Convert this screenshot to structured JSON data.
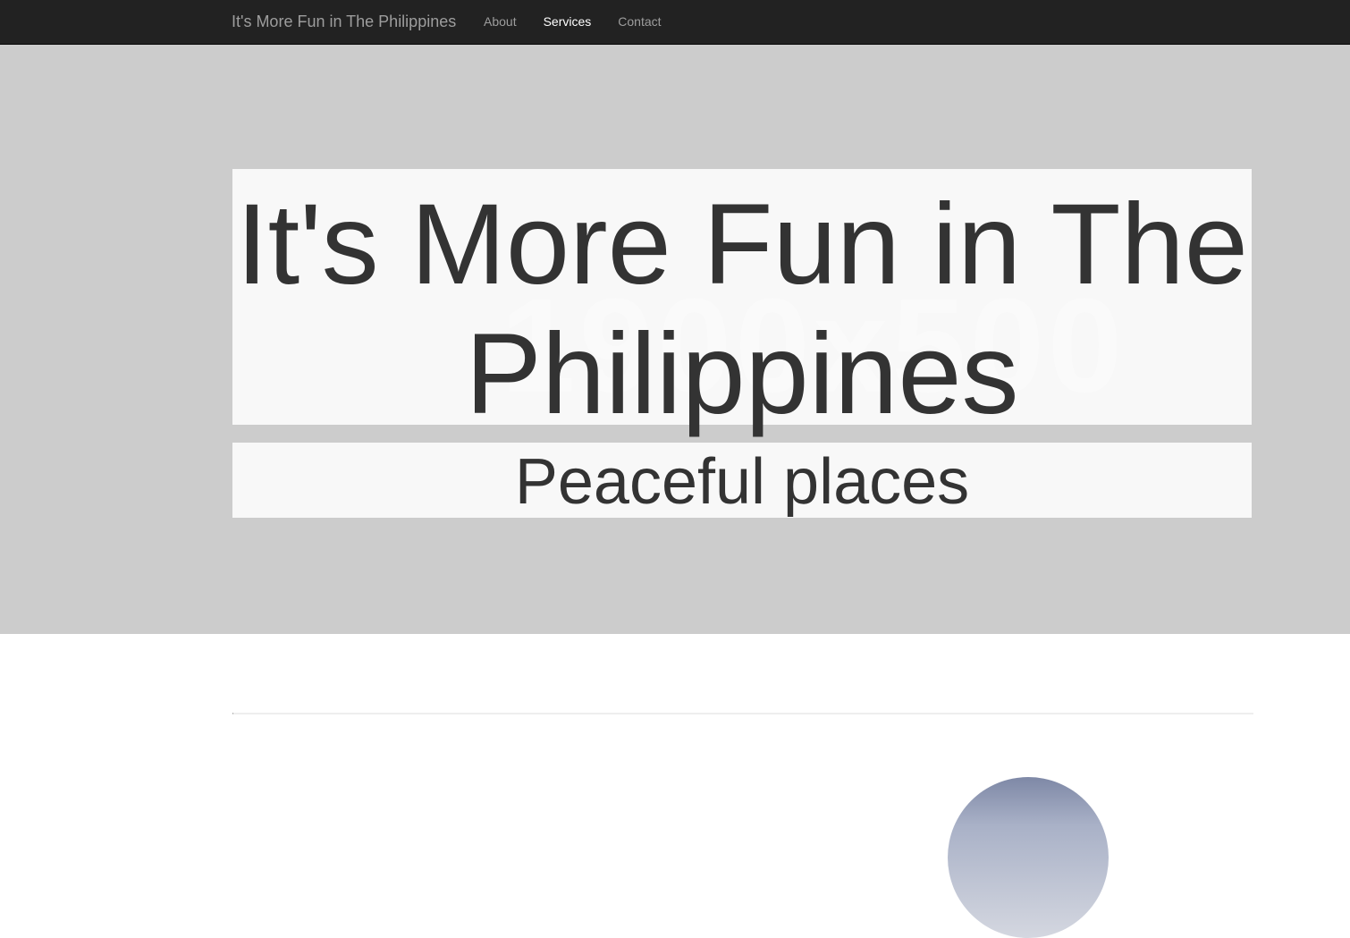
{
  "navbar": {
    "brand": "It's More Fun in The Philippines",
    "links": [
      {
        "label": "About",
        "active": false
      },
      {
        "label": "Services",
        "active": true
      },
      {
        "label": "Contact",
        "active": false
      }
    ]
  },
  "hero": {
    "watermark": "1900x500",
    "title": "It's More Fun in The Philippines",
    "subtitle": "Peaceful places",
    "background_color": "#cccccc"
  },
  "colors": {
    "navbar_bg": "#222222",
    "nav_text": "#9d9d9d",
    "nav_active": "#ffffff",
    "hero_text": "#333333"
  }
}
